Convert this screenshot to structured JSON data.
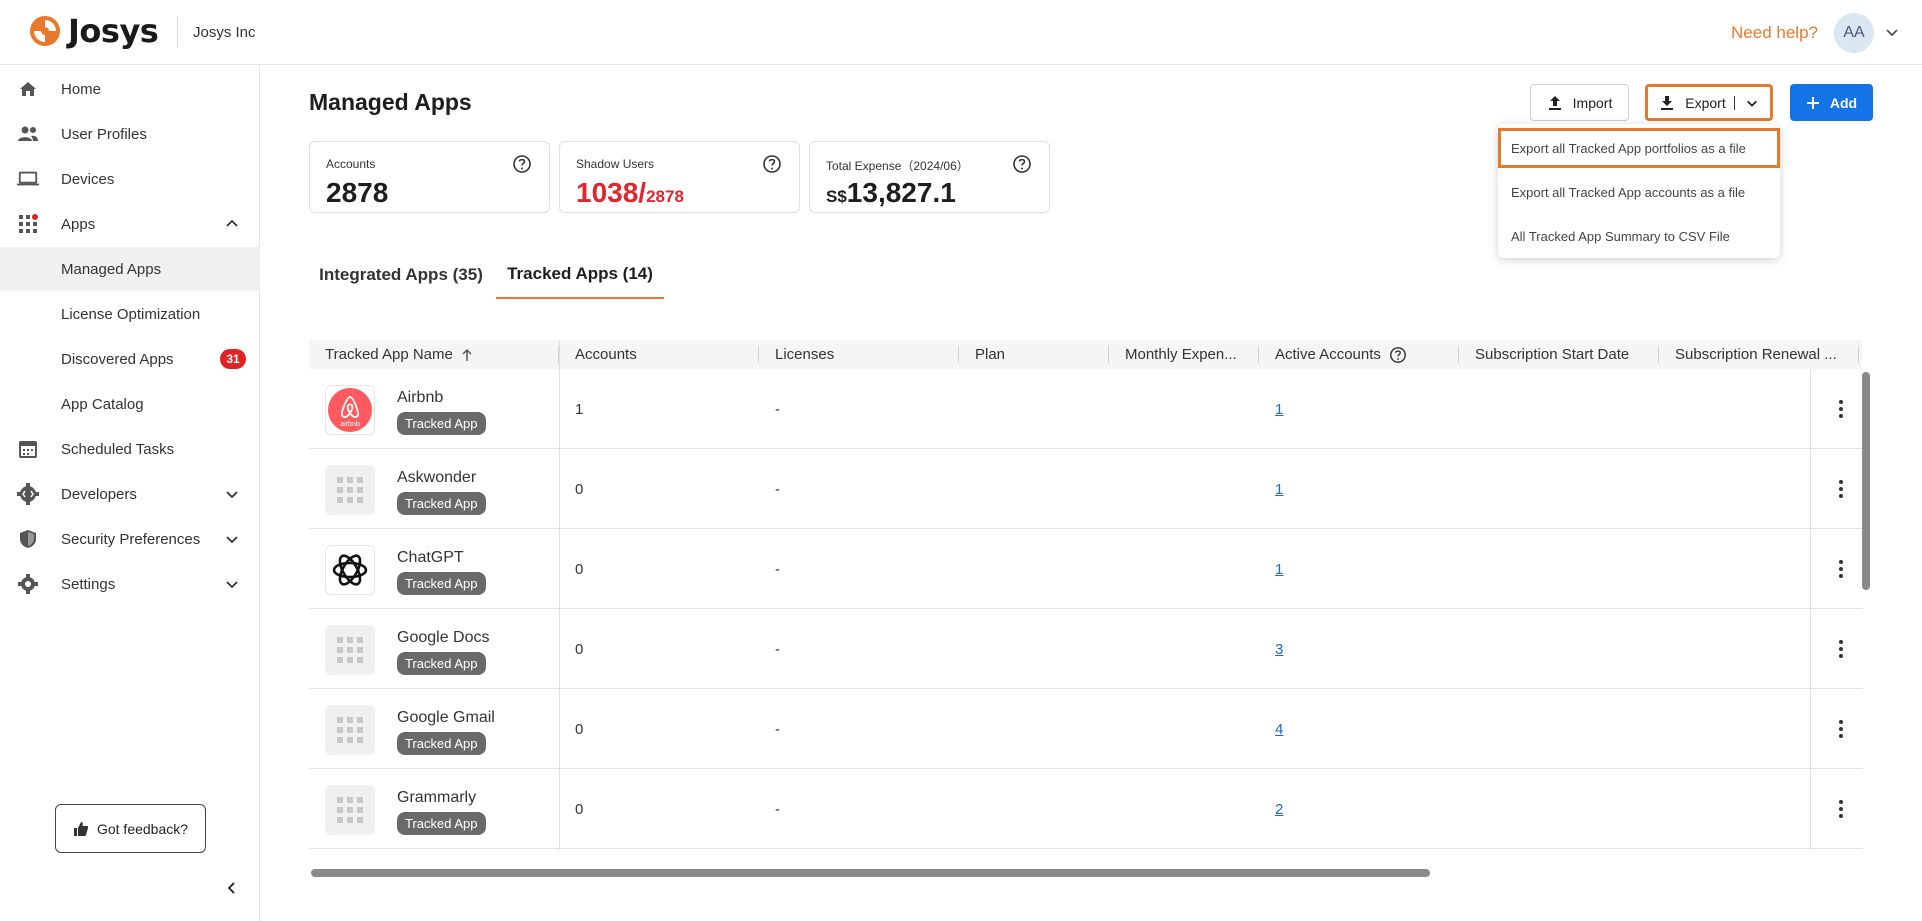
{
  "header": {
    "logo_text": "Josys",
    "org_name": "Josys Inc",
    "help_label": "Need help?",
    "avatar_initials": "AA"
  },
  "sidebar": {
    "items": [
      {
        "label": "Home",
        "icon": "home-icon"
      },
      {
        "label": "User Profiles",
        "icon": "users-icon"
      },
      {
        "label": "Devices",
        "icon": "laptop-icon"
      },
      {
        "label": "Apps",
        "icon": "apps-grid-icon"
      },
      {
        "label": "Managed Apps"
      },
      {
        "label": "License Optimization"
      },
      {
        "label": "Discovered Apps",
        "badge": "31"
      },
      {
        "label": "App Catalog"
      },
      {
        "label": "Scheduled Tasks",
        "icon": "calendar-icon"
      },
      {
        "label": "Developers",
        "icon": "developer-gear-icon"
      },
      {
        "label": "Security Preferences",
        "icon": "shield-icon"
      },
      {
        "label": "Settings",
        "icon": "gear-icon"
      }
    ],
    "feedback_label": "Got feedback?"
  },
  "main": {
    "title": "Managed Apps",
    "buttons": {
      "import": "Import",
      "export": "Export",
      "add": "Add"
    },
    "stats": {
      "accounts_label": "Accounts",
      "accounts_value": "2878",
      "shadow_label": "Shadow Users",
      "shadow_value": "1038/",
      "shadow_total": "2878",
      "expense_label": "Total Expense（2024/06）",
      "expense_currency": "S$",
      "expense_value": "13,827.1"
    },
    "tabs": [
      {
        "label": "Integrated Apps (35)"
      },
      {
        "label": "Tracked Apps (14)",
        "active": true
      }
    ],
    "export_menu": [
      "Export all Tracked App portfolios as a file",
      "Export all Tracked App accounts as a file",
      "All Tracked App Summary to CSV File"
    ],
    "table": {
      "columns": [
        "Tracked App Name",
        "Accounts",
        "Licenses",
        "Plan",
        "Monthly Expen...",
        "Active Accounts",
        "Subscription Start Date",
        "Subscription Renewal ..."
      ],
      "rows": [
        {
          "name": "Airbnb",
          "tag": "Tracked App",
          "accounts": "1",
          "licenses": "-",
          "active": "1",
          "logo": "airbnb-logo"
        },
        {
          "name": "Askwonder",
          "tag": "Tracked App",
          "accounts": "0",
          "licenses": "-",
          "active": "1",
          "logo": "placeholder-grid-icon"
        },
        {
          "name": "ChatGPT",
          "tag": "Tracked App",
          "accounts": "0",
          "licenses": "-",
          "active": "1",
          "logo": "chatgpt-logo"
        },
        {
          "name": "Google Docs",
          "tag": "Tracked App",
          "accounts": "0",
          "licenses": "-",
          "active": "3",
          "logo": "placeholder-grid-icon"
        },
        {
          "name": "Google Gmail",
          "tag": "Tracked App",
          "accounts": "0",
          "licenses": "-",
          "active": "4",
          "logo": "placeholder-grid-icon"
        },
        {
          "name": "Grammarly",
          "tag": "Tracked App",
          "accounts": "0",
          "licenses": "-",
          "active": "2",
          "logo": "placeholder-grid-icon"
        }
      ]
    }
  },
  "colors": {
    "brand_orange": "#e8782c",
    "primary_blue": "#1473e6",
    "alert_red": "#e0262c",
    "tag_grey": "#6a6a6a"
  }
}
